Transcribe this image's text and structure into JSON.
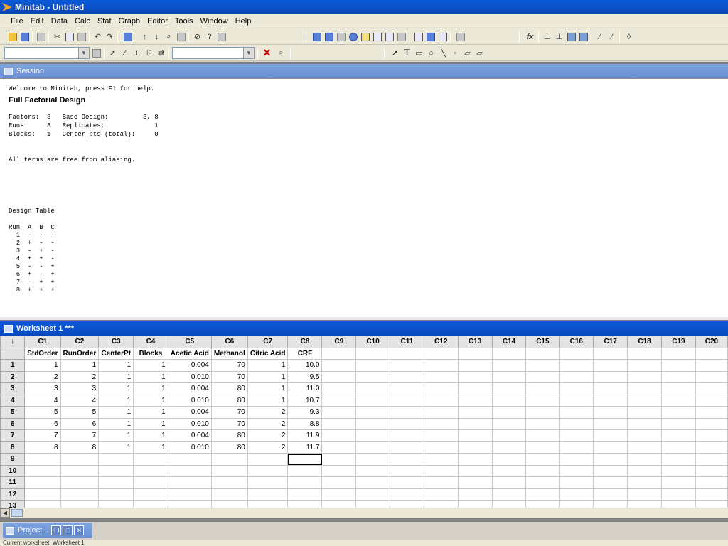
{
  "app": {
    "title": "Minitab - Untitled"
  },
  "menu": [
    "File",
    "Edit",
    "Data",
    "Calc",
    "Stat",
    "Graph",
    "Editor",
    "Tools",
    "Window",
    "Help"
  ],
  "session": {
    "title": "Session",
    "welcome": "Welcome to Minitab, press F1 for help.",
    "heading": "Full Factorial Design",
    "summary": [
      "Factors:  3   Base Design:         3, 8",
      "Runs:     8   Replicates:             1",
      "Blocks:   1   Center pts (total):     0"
    ],
    "aliasing": "All terms are free from aliasing.",
    "design_table_title": "Design Table",
    "design_table": [
      "Run  A  B  C",
      "  1  -  -  -",
      "  2  +  -  -",
      "  3  -  +  -",
      "  4  +  +  -",
      "  5  -  -  +",
      "  6  +  -  +",
      "  7  -  +  +",
      "  8  +  +  +"
    ]
  },
  "worksheet": {
    "title": "Worksheet 1 ***",
    "corner": "↓",
    "columns": [
      "C1",
      "C2",
      "C3",
      "C4",
      "C5",
      "C6",
      "C7",
      "C8",
      "C9",
      "C10",
      "C11",
      "C12",
      "C13",
      "C14",
      "C15",
      "C16",
      "C17",
      "C18",
      "C19",
      "C20"
    ],
    "column_names": [
      "StdOrder",
      "RunOrder",
      "CenterPt",
      "Blocks",
      "Acetic Acid",
      "Methanol",
      "Citric Acid",
      "CRF",
      "",
      "",
      "",
      "",
      "",
      "",
      "",
      "",
      "",
      "",
      "",
      ""
    ],
    "rows": [
      [
        "1",
        "1",
        "1",
        "1",
        "0.004",
        "70",
        "1",
        "10.0"
      ],
      [
        "2",
        "2",
        "1",
        "1",
        "0.010",
        "70",
        "1",
        "9.5"
      ],
      [
        "3",
        "3",
        "1",
        "1",
        "0.004",
        "80",
        "1",
        "11.0"
      ],
      [
        "4",
        "4",
        "1",
        "1",
        "0.010",
        "80",
        "1",
        "10.7"
      ],
      [
        "5",
        "5",
        "1",
        "1",
        "0.004",
        "70",
        "2",
        "9.3"
      ],
      [
        "6",
        "6",
        "1",
        "1",
        "0.010",
        "70",
        "2",
        "8.8"
      ],
      [
        "7",
        "7",
        "1",
        "1",
        "0.004",
        "80",
        "2",
        "11.9"
      ],
      [
        "8",
        "8",
        "1",
        "1",
        "0.010",
        "80",
        "2",
        "11.7"
      ]
    ],
    "row_numbers": [
      "1",
      "2",
      "3",
      "4",
      "5",
      "6",
      "7",
      "8",
      "9",
      "10",
      "11",
      "12",
      "13"
    ]
  },
  "project_window": {
    "label": "Project..."
  },
  "status_text": "Current worksheet: Worksheet 1"
}
